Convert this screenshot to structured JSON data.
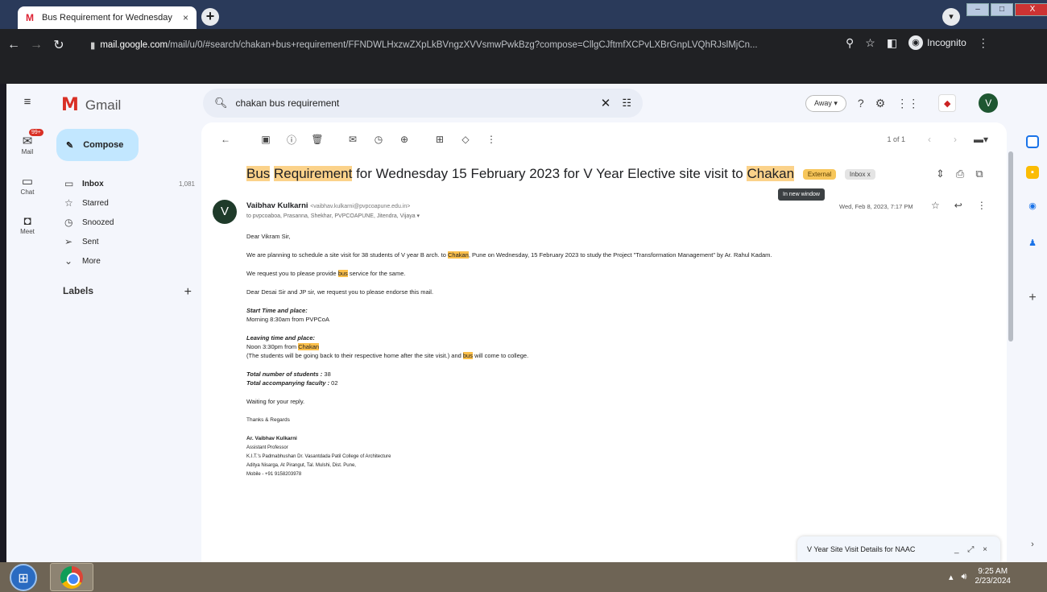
{
  "browser": {
    "tab_title": "Bus Requirement for Wednesday",
    "tab_close": "×",
    "new_tab": "+",
    "url_host": "mail.google.com",
    "url_path": "/mail/u/0/#search/chakan+bus+requirement/FFNDWLHxzwZXpLkBVngzXVVsmwPwkBzg?compose=CllgCJftmfXCPvLXBrGnpLVQhRJslMjCn...",
    "incognito_label": "Incognito",
    "window_controls": [
      "–",
      "□",
      "X"
    ]
  },
  "gmail": {
    "brand": "Gmail",
    "search_value": "chakan bus requirement",
    "status": "Away",
    "avatar_letter": "V",
    "compose_label": "Compose",
    "rail": [
      {
        "label": "Mail",
        "icon": "mail-icon",
        "badge": "99+"
      },
      {
        "label": "Chat",
        "icon": "chat-icon"
      },
      {
        "label": "Meet",
        "icon": "meet-icon"
      }
    ],
    "nav": [
      {
        "label": "Inbox",
        "count": "1,081",
        "icon": "inbox-icon"
      },
      {
        "label": "Starred",
        "count": "",
        "icon": "star-icon"
      },
      {
        "label": "Snoozed",
        "count": "",
        "icon": "clock-icon"
      },
      {
        "label": "Sent",
        "count": "",
        "icon": "send-icon"
      },
      {
        "label": "More",
        "count": "",
        "icon": "chevron-down-icon"
      }
    ],
    "labels_heading": "Labels",
    "labels_add": "+"
  },
  "email": {
    "pager": "1 of 1",
    "subject_parts": [
      "Bus",
      " ",
      "Requirement",
      " for Wednesday 15 February 2023 for V Year Elective site visit to ",
      "Chakan"
    ],
    "chip_external": "External",
    "chip_inbox": "Inbox x",
    "tooltip": "In new window",
    "sender_name": "Vaibhav Kulkarni",
    "sender_email": "<vaibhav.kulkarni@pvpcoapune.edu.in>",
    "recipients": "to pvpcoaboa, Prasanna, Shekhar, PVPCOAPUNE, Jitendra, Vijaya ▾",
    "date": "Wed, Feb 8, 2023, 7:17 PM",
    "avatar_letter": "V",
    "greeting": "Dear Vikram Sir,",
    "line1_a": "We are planning to schedule a site visit for 38 students of V year B arch. to ",
    "line1_hl": "Chakan",
    "line1_b": ", Pune on Wednesday, 15 February 2023 to study the Project \"Transformation Management\" by Ar. Rahul Kadam.",
    "line2_a": "We request you to please provide ",
    "line2_hl": "bus",
    "line2_b": " service for the same.",
    "line3": "Dear Desai Sir and JP sir, we request you to please endorse this mail.",
    "start_heading": "Start Time and place:",
    "start_value": "Morning 8:30am from PVPCoA",
    "leave_heading": "Leaving time and place:",
    "leave_a": "Noon 3:30pm from ",
    "leave_hl": "Chakan",
    "leave_note_a": "(The students will be going back to their respective home after the site visit.) and ",
    "leave_note_hl": "bus",
    "leave_note_b": " will come to college.",
    "total_students_label": "Total number of students :",
    "total_students": "38",
    "total_faculty_label": "Total accompanying faculty :",
    "total_faculty": "02",
    "closing1": "Waiting for your reply.",
    "closing2": "Thanks & Regards",
    "sig_name": "Ar. Vaibhav Kulkarni",
    "sig_title": "Assistant Professor",
    "sig_college": "K.I.T.'s Padmabhushan Dr. Vasantdada Patil College of Architecture",
    "sig_address": "Aditya Nisarga, At Pirangut, Tal. Mulshi, Dist. Pune,",
    "sig_mobile": "Mobile - +91 9158203978"
  },
  "draft": {
    "title": "V Year Site Visit Details for NAAC",
    "controls": "_ ⤢ ×"
  },
  "taskbar": {
    "time": "9:25 AM",
    "date": "2/23/2024"
  },
  "colors": {
    "highlight": "#fbd28a",
    "compose_bg": "#c2e7ff",
    "gmail_bg": "#f4f6fc"
  }
}
